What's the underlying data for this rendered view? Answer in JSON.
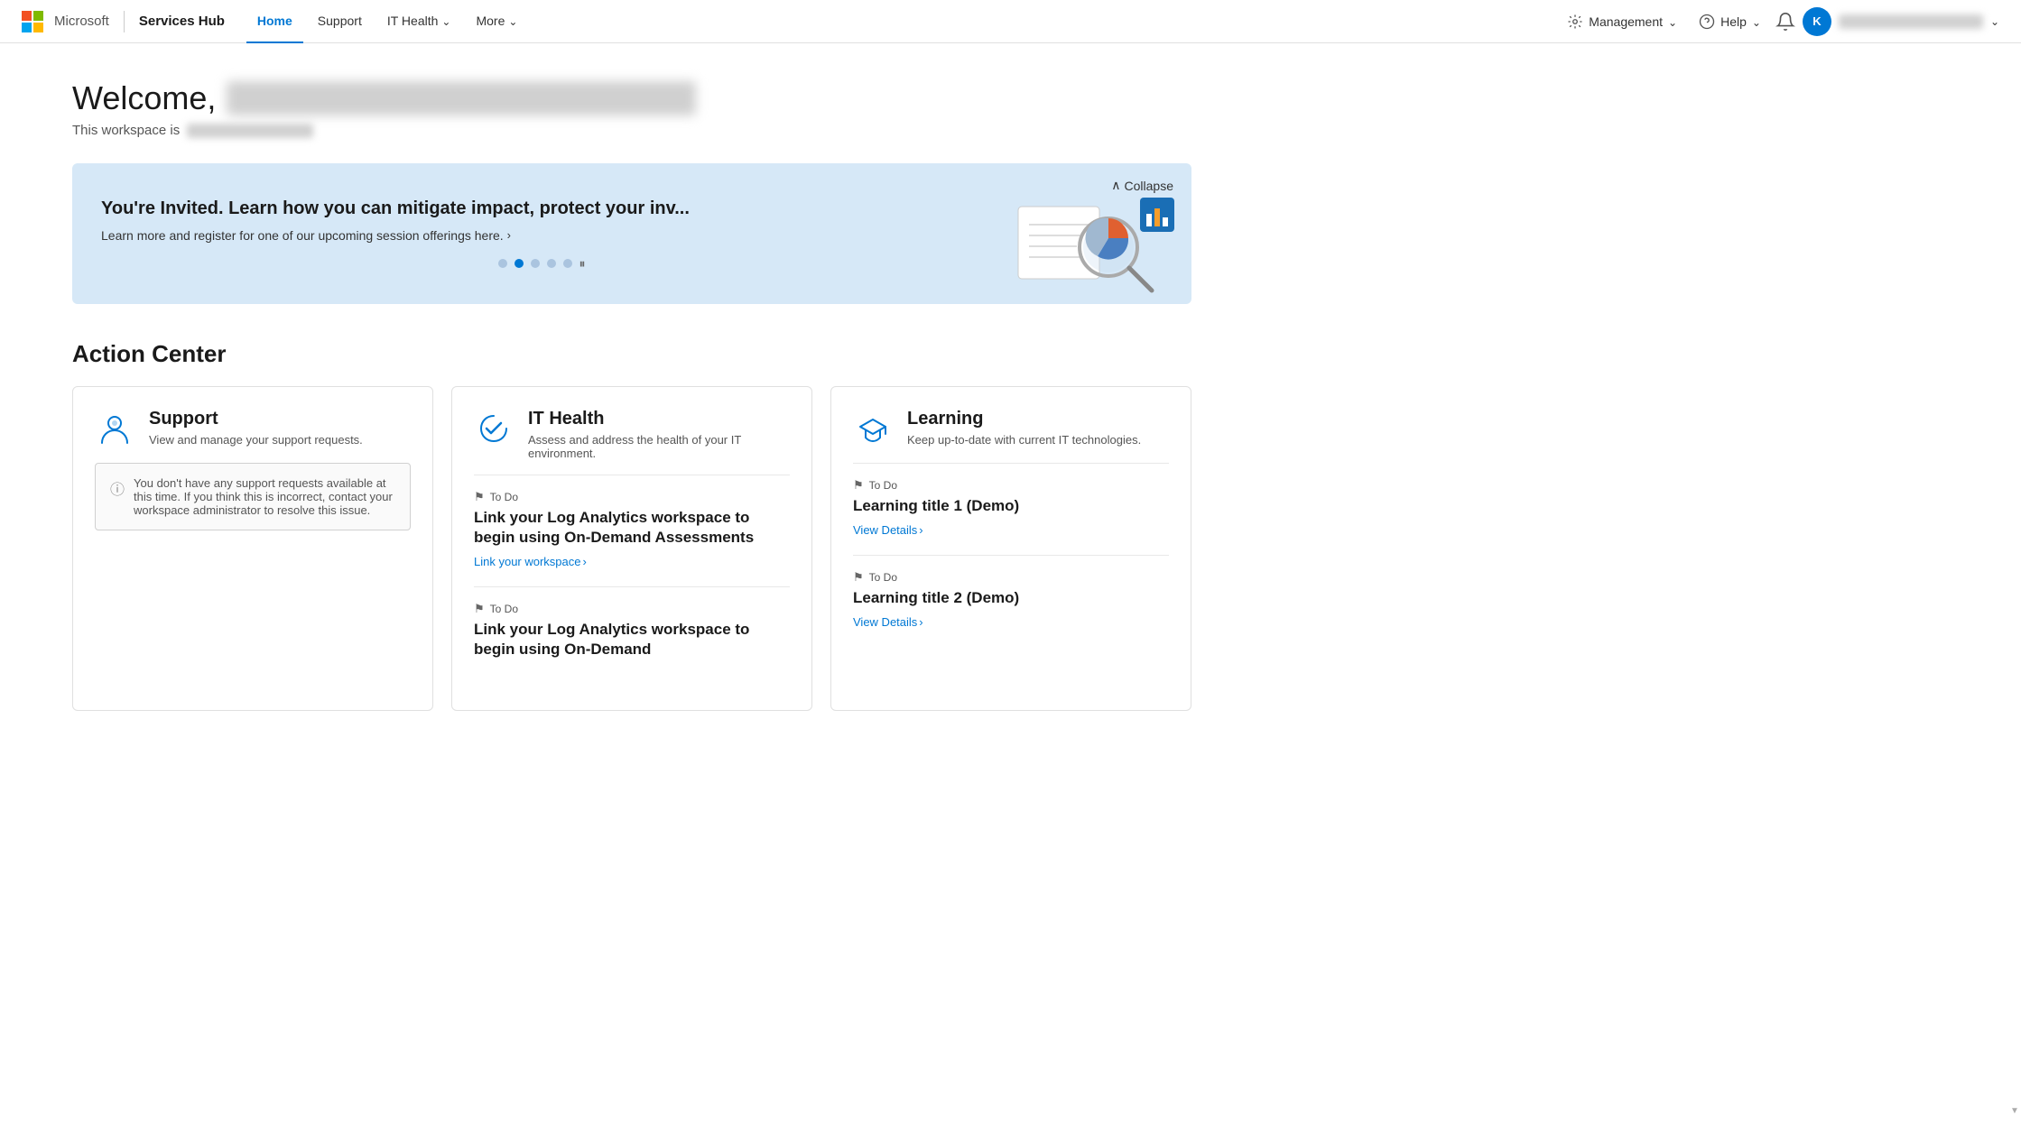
{
  "nav": {
    "brand": "Services Hub",
    "links": [
      {
        "label": "Home",
        "active": true
      },
      {
        "label": "Support",
        "active": false
      },
      {
        "label": "IT Health",
        "active": false,
        "hasChevron": true
      },
      {
        "label": "More",
        "active": false,
        "hasChevron": true
      }
    ],
    "management": "Management",
    "help": "Help",
    "avatarInitial": "K"
  },
  "welcome": {
    "prefix": "Welcome,",
    "workspace_prefix": "This workspace is"
  },
  "banner": {
    "title": "You're Invited. Learn how you can mitigate impact, protect your inv...",
    "subtitle": "Learn more and register for one of our upcoming session offerings here.",
    "collapse_label": "Collapse",
    "dots": [
      1,
      2,
      3,
      4,
      5
    ],
    "active_dot": 2
  },
  "action_center": {
    "title": "Action Center",
    "cards": [
      {
        "id": "support",
        "title": "Support",
        "subtitle": "View and manage your support requests.",
        "info_text": "You don't have any support requests available at this time. If you think this is incorrect, contact your workspace administrator to resolve this issue.",
        "todo_items": []
      },
      {
        "id": "it-health",
        "title": "IT Health",
        "subtitle": "Assess and address the health of your IT environment.",
        "todo_items": [
          {
            "label": "To Do",
            "title": "Link your Log Analytics workspace to begin using On-Demand Assessments",
            "link_label": "Link your workspace",
            "link_arrow": ">"
          },
          {
            "label": "To Do",
            "title": "Link your Log Analytics workspace to begin using On-Demand",
            "link_label": "",
            "link_arrow": ""
          }
        ]
      },
      {
        "id": "learning",
        "title": "Learning",
        "subtitle": "Keep up-to-date with current IT technologies.",
        "todo_items": [
          {
            "label": "To Do",
            "title": "Learning title 1 (Demo)",
            "link_label": "View Details",
            "link_arrow": ">"
          },
          {
            "label": "To Do",
            "title": "Learning title 2 (Demo)",
            "link_label": "View Details",
            "link_arrow": ">"
          }
        ]
      }
    ]
  }
}
